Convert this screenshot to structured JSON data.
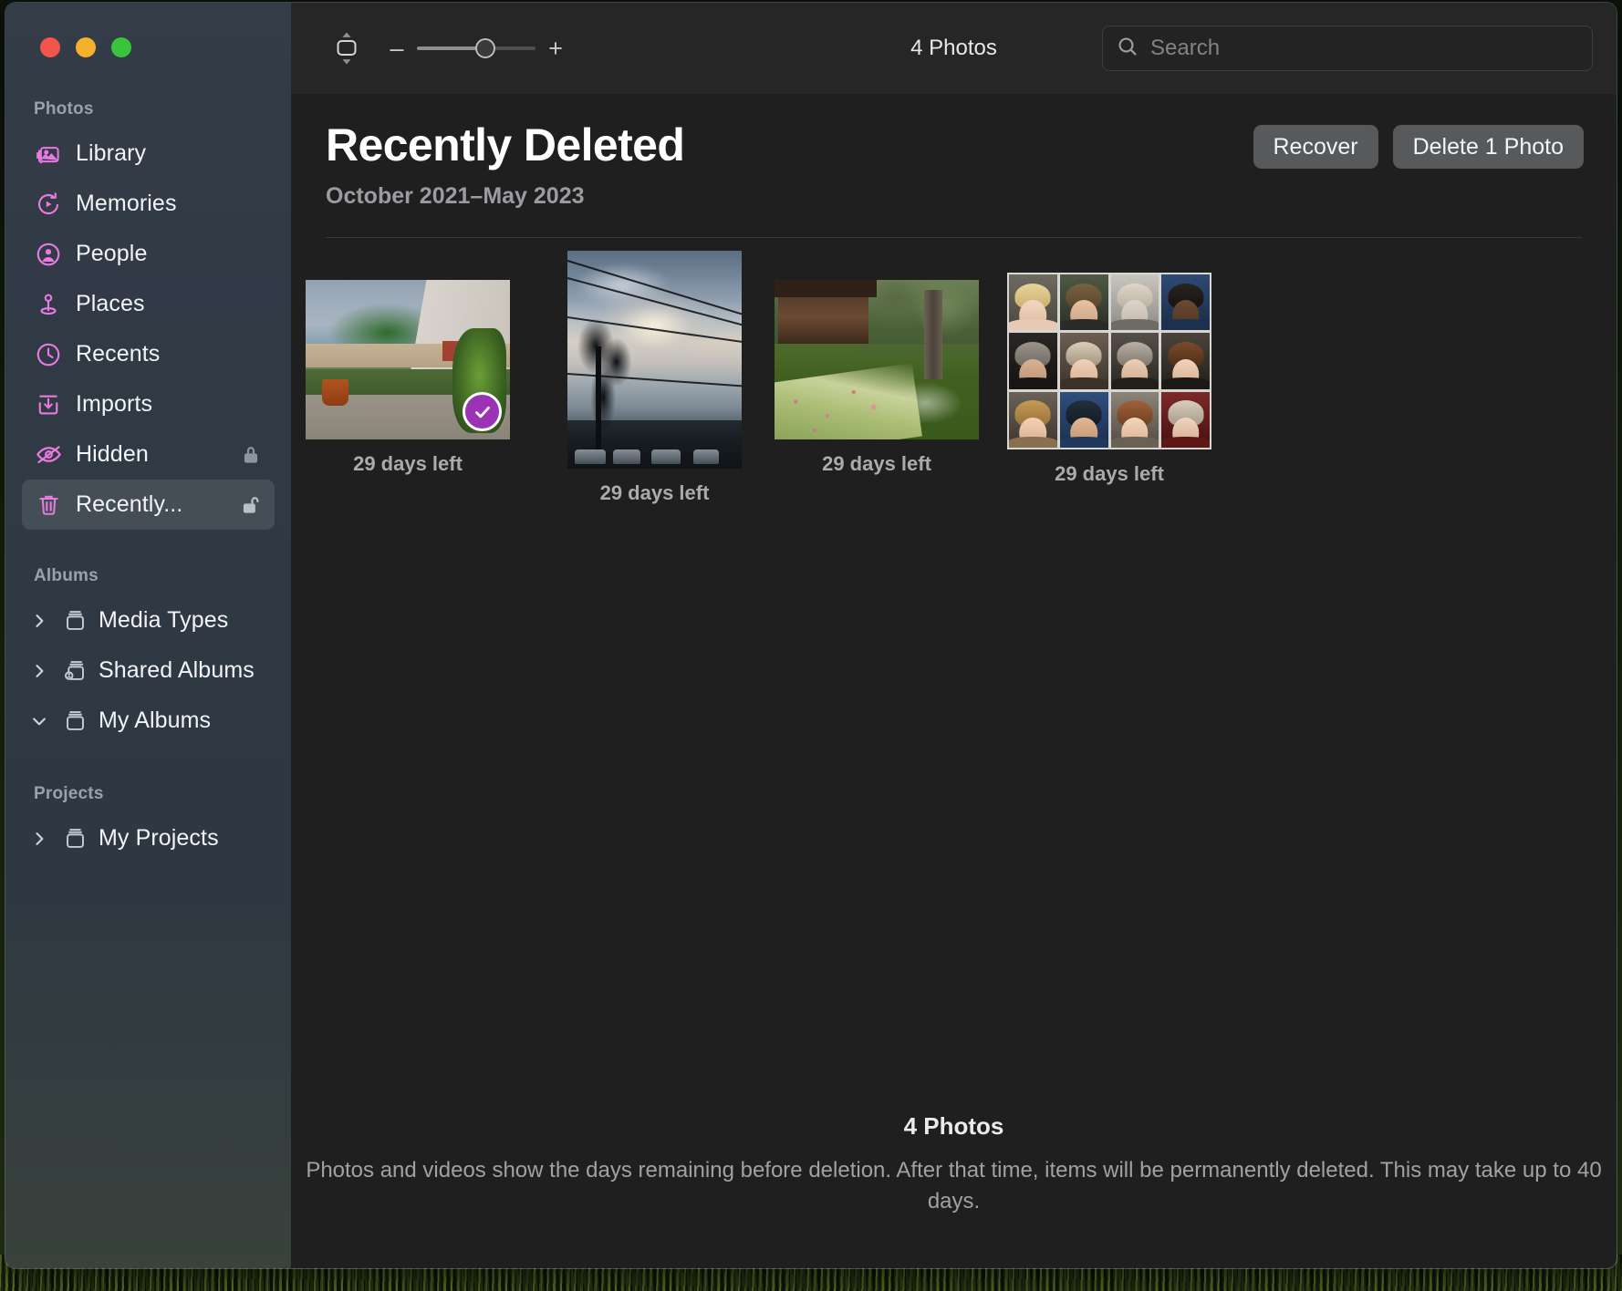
{
  "window": {
    "traffic_lights": [
      "close",
      "minimize",
      "zoom"
    ]
  },
  "toolbar": {
    "sidebar_toggle_icon": "sidebar-resize-icon",
    "zoom_minus_label": "–",
    "zoom_plus_label": "+",
    "zoom_value_percent": 55,
    "photo_count": "4 Photos",
    "search_icon": "search-icon",
    "search_value": "",
    "search_placeholder": "Search"
  },
  "sidebar": {
    "sections": [
      {
        "title": "Photos",
        "items": [
          {
            "label": "Library",
            "icon": "library-icon",
            "selected": false,
            "trailing": null
          },
          {
            "label": "Memories",
            "icon": "memories-icon",
            "selected": false,
            "trailing": null
          },
          {
            "label": "People",
            "icon": "people-icon",
            "selected": false,
            "trailing": null
          },
          {
            "label": "Places",
            "icon": "places-icon",
            "selected": false,
            "trailing": null
          },
          {
            "label": "Recents",
            "icon": "recents-icon",
            "selected": false,
            "trailing": null
          },
          {
            "label": "Imports",
            "icon": "imports-icon",
            "selected": false,
            "trailing": null
          },
          {
            "label": "Hidden",
            "icon": "hidden-eye-icon",
            "selected": false,
            "trailing": "lock-closed-icon"
          },
          {
            "label": "Recently...",
            "icon": "trash-icon",
            "selected": true,
            "trailing": "lock-open-icon"
          }
        ]
      },
      {
        "title": "Albums",
        "items": [
          {
            "label": "Media Types",
            "icon": "album-box-icon",
            "chevron": "chevron-right",
            "expanded": false
          },
          {
            "label": "Shared Albums",
            "icon": "shared-album-box-icon",
            "chevron": "chevron-right",
            "expanded": false
          },
          {
            "label": "My Albums",
            "icon": "album-box-icon",
            "chevron": "chevron-down",
            "expanded": true
          }
        ]
      },
      {
        "title": "Projects",
        "items": [
          {
            "label": "My Projects",
            "icon": "album-box-icon",
            "chevron": "chevron-right",
            "expanded": false
          }
        ]
      }
    ]
  },
  "header": {
    "title": "Recently Deleted",
    "date_range": "October 2021–May 2023",
    "recover_label": "Recover",
    "delete_label": "Delete 1 Photo"
  },
  "photos": [
    {
      "days_left": "29 days left",
      "selected": true,
      "subject": "courtyard-garden"
    },
    {
      "days_left": "29 days left",
      "selected": false,
      "subject": "sunset-sky-power-lines"
    },
    {
      "days_left": "29 days left",
      "selected": false,
      "subject": "japanese-garden-pond"
    },
    {
      "days_left": "29 days left",
      "selected": false,
      "subject": "celebrity-face-grid"
    }
  ],
  "footer": {
    "count": "4 Photos",
    "description": "Photos and videos show the days remaining before deletion. After that time, items will be permanently deleted. This may take up to 40 days."
  },
  "colors": {
    "accent_purple": "#9c33b5",
    "sidebar_icon_pink": "#e87ae0",
    "window_bg": "#1f1f20",
    "toolbar_bg": "#262627",
    "button_bg": "#58595b"
  }
}
